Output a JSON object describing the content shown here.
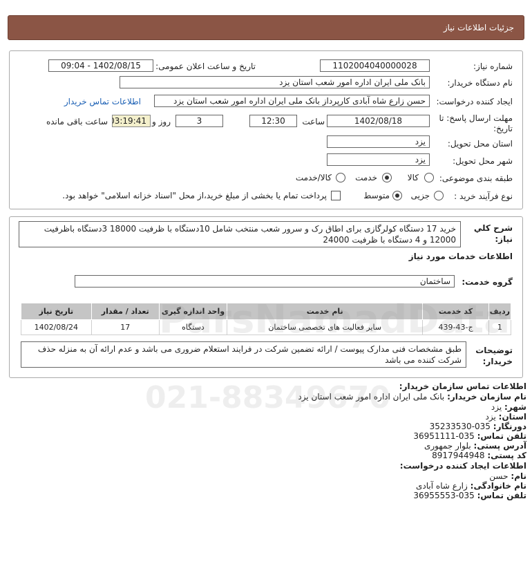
{
  "header": {
    "title": "جزئیات اطلاعات نیاز"
  },
  "form": {
    "need_number_label": "شماره نیاز:",
    "need_number": "1102004040000028",
    "announce_label": "تاریخ و ساعت اعلان عمومی:",
    "announce_value": "1402/08/15 - 09:04",
    "buyer_label": "نام دستگاه خریدار:",
    "buyer_value": "بانک ملی ایران اداره امور شعب استان یزد",
    "creator_label": "ایجاد کننده درخواست:",
    "creator_value": "حسن زارع شاه آبادی کارپرداز بانک ملی ایران اداره امور شعب استان یزد",
    "contact_link": "اطلاعات تماس خریدار",
    "deadline_label_1": "مهلت ارسال پاسخ: تا",
    "deadline_label_2": "تاریخ:",
    "deadline_date": "1402/08/18",
    "time_label": "ساعت",
    "deadline_time": "12:30",
    "days_value": "3",
    "days_label": "روز و",
    "remaining_time": "03:19:41",
    "remaining_label": "ساعت باقی مانده",
    "province_label": "استان محل تحویل:",
    "province_value": "یزد",
    "city_label": "شهر محل تحویل:",
    "city_value": "یزد",
    "category_label": "طبقه بندی موضوعی:",
    "category_options": [
      "کالا",
      "خدمت",
      "کالا/خدمت"
    ],
    "category_selected": "خدمت",
    "process_label": "نوع فرآیند خرید :",
    "process_options": [
      "جزیی",
      "متوسط"
    ],
    "process_selected": "متوسط",
    "payment_note": "پرداخت تمام یا بخشی از مبلغ خرید،از محل \"اسناد خزانه اسلامی\" خواهد بود."
  },
  "summary": {
    "label_1": "شرح کلي",
    "label_2": "نياز:",
    "text": "خرید 17 دستگاه کولرگازی برای اطاق رک و سرور شعب منتخب شامل 10دستگاه با ظرفیت 18000 3دستگاه باظرفیت 12000 و 4 دستگاه با ظرفیت 24000"
  },
  "services": {
    "section_title": "اطلاعات خدمات مورد نیاز",
    "group_label": "گروه خدمت:",
    "group_value": "ساختمان",
    "columns": [
      "ردیف",
      "کد خدمت",
      "نام خدمت",
      "واحد اندازه گیری",
      "تعداد / مقدار",
      "تاریخ نیاز"
    ],
    "rows": [
      [
        "1",
        "ج-43-439",
        "سایر فعالیت های تخصصی ساختمان",
        "دستگاه",
        "17",
        "1402/08/24"
      ]
    ]
  },
  "notes": {
    "label_1": "توضیحات",
    "label_2": "خریدار:",
    "text": "طبق مشخصات فنی مدارک پیوست / ارائه تضمین شرکت در فرایند استعلام ضروری می باشد و عدم ارائه آن به منزله حذف شرکت کننده می باشد"
  },
  "contact": {
    "org_heading": "اطلاعات تماس سازمان خریدار:",
    "org_name_label": "نام سازمان خریدار:",
    "org_name_value": "بانک ملی ایران اداره امور شعب استان یزد",
    "city_label": "شهر:",
    "city_value": "یزد",
    "province_label": "استان:",
    "province_value": "یزد",
    "fax_label": "دورنگار:",
    "fax_value": "035-35233530",
    "phone_label": "تلفن تماس:",
    "phone_value": "035-36951111",
    "address_label": "آدرس پستی:",
    "address_value": "بلوار جمهوری",
    "postal_label": "کد پستی:",
    "postal_value": "8917944948",
    "creator_heading": "اطلاعات ایجاد کننده درخواست:",
    "first_name_label": "نام:",
    "first_name_value": "حسن",
    "last_name_label": "نام خانوادگی:",
    "last_name_value": "زارع شاه آبادی",
    "creator_phone_label": "تلفن تماس:",
    "creator_phone_value": "035-36955553"
  },
  "watermark": {
    "brand": "ParsNamadData",
    "phone": "021-88349670"
  }
}
